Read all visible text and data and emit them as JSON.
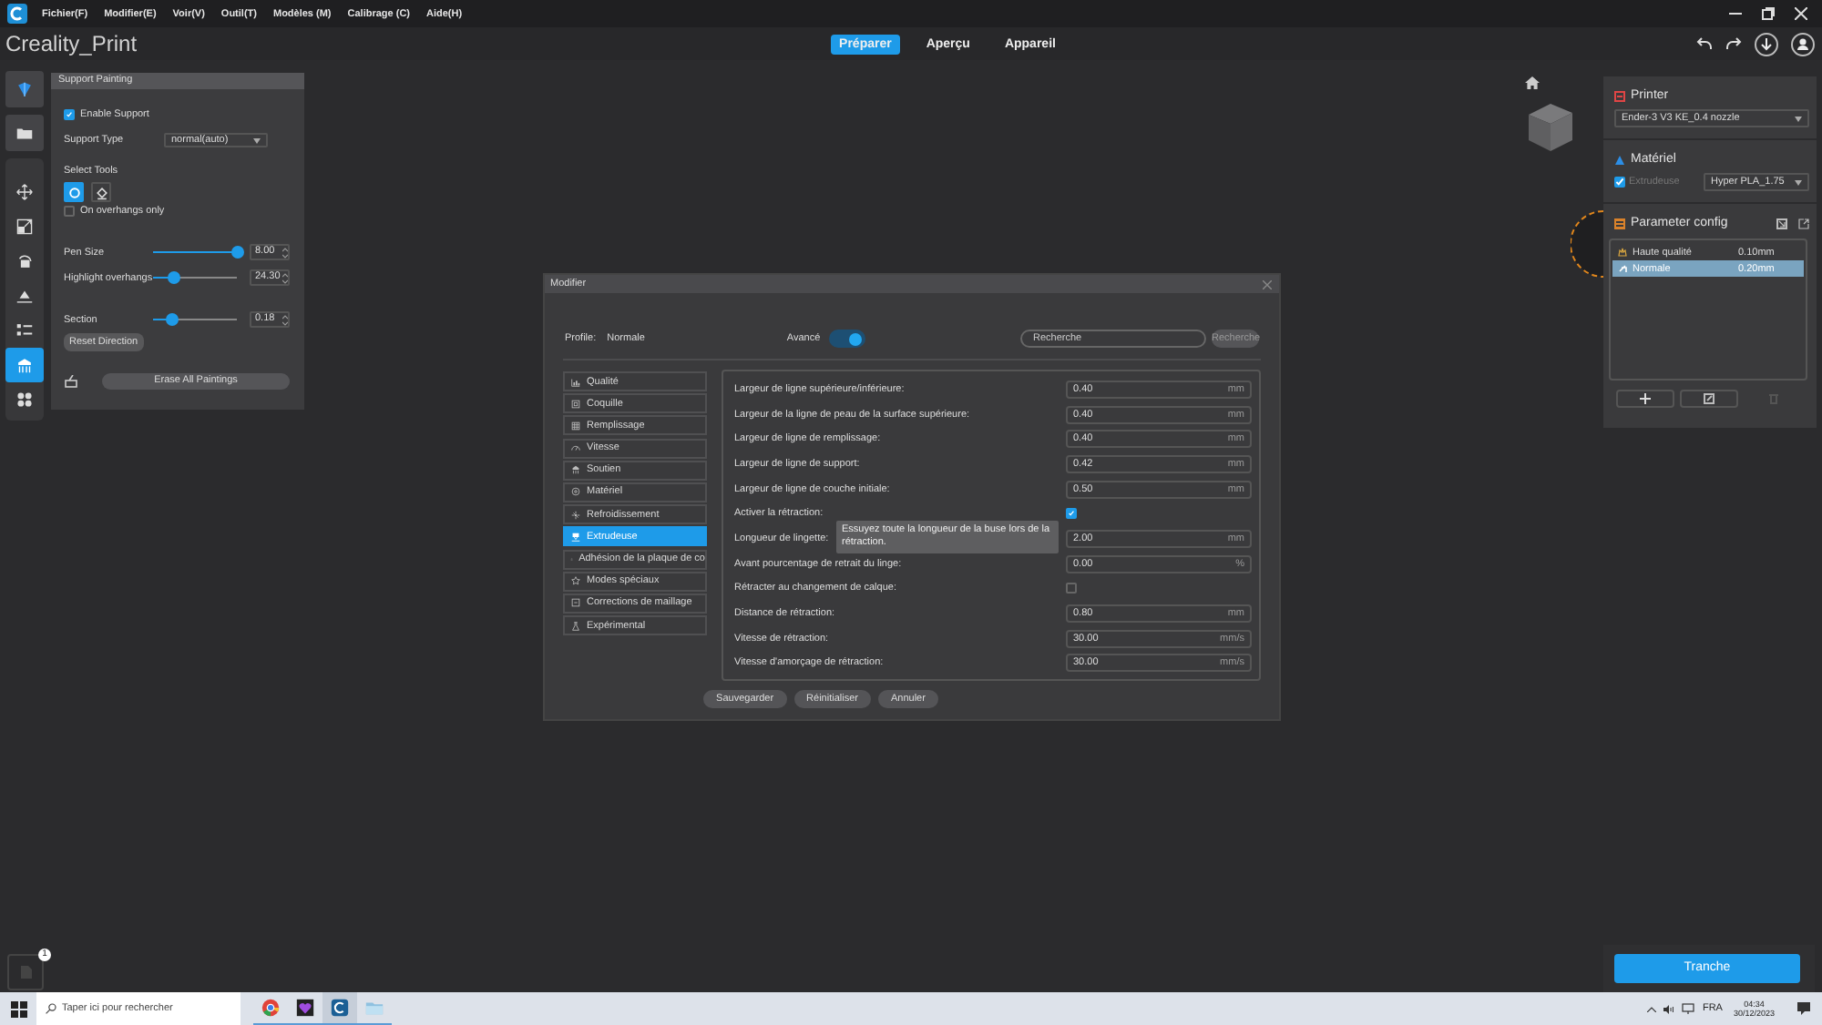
{
  "menu": [
    "Fichier(F)",
    "Modifier(E)",
    "Voir(V)",
    "Outil(T)",
    "Modèles (M)",
    "Calibrage (C)",
    "Aide(H)"
  ],
  "app_title": "Creality_Print",
  "tabs": [
    {
      "label": "Préparer",
      "selected": true
    },
    {
      "label": "Aperçu",
      "selected": false
    },
    {
      "label": "Appareil",
      "selected": false
    }
  ],
  "tools": [
    {
      "kind": "logo",
      "selected": false
    },
    {
      "kind": "open",
      "selected": false
    },
    {
      "kind": "move",
      "selected": false
    },
    {
      "kind": "scale",
      "selected": false
    },
    {
      "kind": "rotate",
      "selected": false
    },
    {
      "kind": "lay",
      "selected": false
    },
    {
      "kind": "list",
      "selected": false
    },
    {
      "kind": "support",
      "selected": true
    },
    {
      "kind": "grid",
      "selected": false
    }
  ],
  "support_painting": {
    "title": "Support Painting",
    "enable_support": {
      "label": "Enable Support",
      "checked": true
    },
    "support_type": {
      "label": "Support Type",
      "value": "normal(auto)"
    },
    "select_tools": {
      "label": "Select Tools",
      "tools": [
        {
          "kind": "circle",
          "selected": true
        },
        {
          "kind": "fill",
          "selected": false
        }
      ]
    },
    "overhangs_only": {
      "label": "On overhangs only",
      "checked": false
    },
    "sliders": [
      {
        "label": "Pen Size",
        "level": 1.0,
        "value": "8.00"
      },
      {
        "label": "Highlight overhangs",
        "level": 0.25,
        "value": "24.30"
      },
      {
        "label": "Section",
        "level": 0.22,
        "value": "0.18"
      }
    ],
    "reset_button": "Reset Direction",
    "erase_button": "Erase All Paintings"
  },
  "modifier": {
    "title": "Modifier",
    "profile_label": "Profile:",
    "profile_value": "Normale",
    "advanced": {
      "label": "Avancé",
      "on": true
    },
    "search": {
      "placeholder": "Recherche"
    },
    "search_button": "Recherche",
    "categories": [
      {
        "label": "Qualité",
        "selected": false
      },
      {
        "label": "Coquille",
        "selected": false
      },
      {
        "label": "Remplissage",
        "selected": false
      },
      {
        "label": "Vitesse",
        "selected": false
      },
      {
        "label": "Soutien",
        "selected": false
      },
      {
        "label": "Matériel",
        "selected": false
      },
      {
        "label": "Refroidissement",
        "selected": false
      },
      {
        "label": "Extrudeuse",
        "selected": true
      },
      {
        "label": "Adhésion de la plaque de co",
        "selected": false
      },
      {
        "label": "Modes spéciaux",
        "selected": false
      },
      {
        "label": "Corrections de maillage",
        "selected": false
      },
      {
        "label": "Expérimental",
        "selected": false
      }
    ],
    "settings": [
      {
        "kind": "number",
        "label": "Largeur de ligne supérieure/inférieure:",
        "value": "0.40",
        "unit": "mm"
      },
      {
        "kind": "number",
        "label": "Largeur de la ligne de peau de la surface supérieure:",
        "value": "0.40",
        "unit": "mm"
      },
      {
        "kind": "number",
        "label": "Largeur de ligne de remplissage:",
        "value": "0.40",
        "unit": "mm"
      },
      {
        "kind": "number",
        "label": "Largeur de ligne de support:",
        "value": "0.42",
        "unit": "mm"
      },
      {
        "kind": "number",
        "label": "Largeur de ligne de couche initiale:",
        "value": "0.50",
        "unit": "mm"
      },
      {
        "kind": "checkbox",
        "label": "Activer la rétraction:",
        "checked": true
      },
      {
        "kind": "number",
        "label": "Longueur de lingette:",
        "value": "2.00",
        "unit": "mm",
        "tooltip": "Essuyez toute la longueur de la buse lors de la rétraction."
      },
      {
        "kind": "number",
        "label": "Avant pourcentage de retrait du linge:",
        "value": "0.00",
        "unit": "%"
      },
      {
        "kind": "checkbox",
        "label": "Rétracter au changement de calque:",
        "checked": false
      },
      {
        "kind": "number",
        "label": "Distance de rétraction:",
        "value": "0.80",
        "unit": "mm"
      },
      {
        "kind": "number",
        "label": "Vitesse de rétraction:",
        "value": "30.00",
        "unit": "mm/s"
      },
      {
        "kind": "number",
        "label": "Vitesse d'amorçage de rétraction:",
        "value": "30.00",
        "unit": "mm/s"
      }
    ],
    "buttons": [
      "Sauvegarder",
      "Réinitialiser",
      "Annuler"
    ]
  },
  "printer_panel": {
    "printer": {
      "title": "Printer",
      "value": "Ender-3 V3 KE_0.4 nozzle"
    },
    "material": {
      "title": "Matériel",
      "extruder": {
        "label": "Extrudeuse",
        "checked": true
      },
      "value": "Hyper PLA_1.75"
    },
    "config": {
      "title": "Parameter config",
      "profiles": [
        {
          "name": "Haute qualité",
          "value": "0.10mm",
          "selected": false
        },
        {
          "name": "Normale",
          "value": "0.20mm",
          "selected": true
        }
      ]
    }
  },
  "file_badge": {
    "count": "1"
  },
  "slice_button": "Tranche",
  "taskbar": {
    "search": {
      "placeholder": "Taper ici pour rechercher"
    },
    "apps": [
      {
        "kind": "browser",
        "selected": false
      },
      {
        "kind": "heart",
        "selected": false
      },
      {
        "kind": "slicer",
        "selected": true
      },
      {
        "kind": "files",
        "selected": false
      }
    ],
    "language": "FRA",
    "time": "04:34",
    "date": "30/12/2023"
  }
}
